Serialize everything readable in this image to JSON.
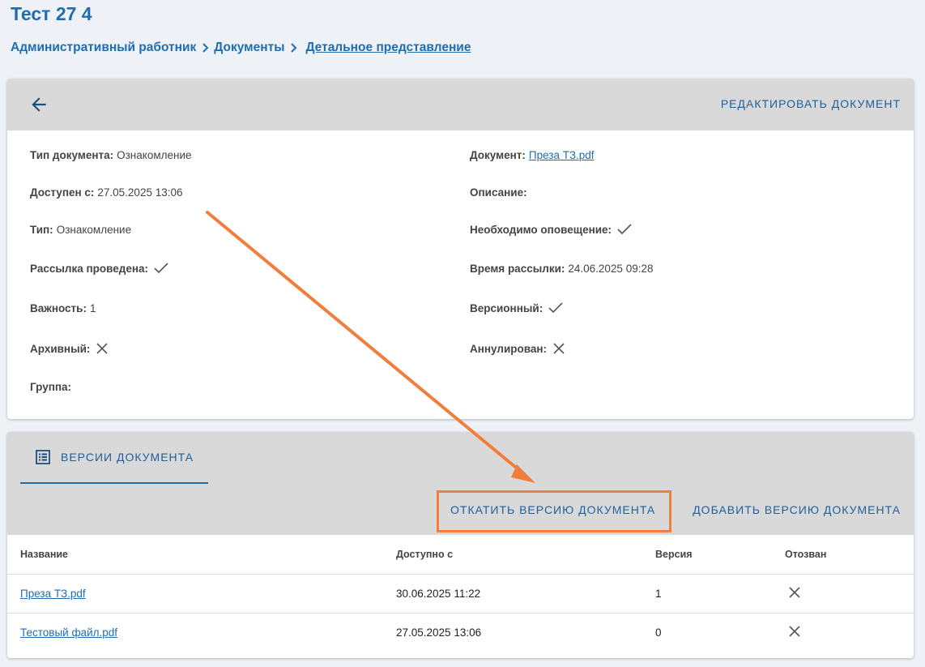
{
  "page": {
    "title": "Тест 27 4"
  },
  "breadcrumb": {
    "items": [
      "Административный работник",
      "Документы",
      "Детальное представление"
    ]
  },
  "details": {
    "edit_label": "РЕДАКТИРОВАТЬ ДОКУМЕНТ",
    "doc_type_label": "Тип документа:",
    "doc_type_value": "Ознакомление",
    "available_label": "Доступен с:",
    "available_value": "27.05.2025 13:06",
    "type_label": "Тип:",
    "type_value": "Ознакомление",
    "mailing_done_label": "Рассылка проведена:",
    "importance_label": "Важность:",
    "importance_value": "1",
    "archived_label": "Архивный:",
    "group_label": "Группа:",
    "document_label": "Документ:",
    "document_value": "Преза ТЗ.pdf",
    "description_label": "Описание:",
    "notify_label": "Необходимо оповещение:",
    "mailing_time_label": "Время рассылки:",
    "mailing_time_value": "24.06.2025 09:28",
    "versioned_label": "Версионный:",
    "annulled_label": "Аннулирован:"
  },
  "versions": {
    "tab_label": "ВЕРСИИ ДОКУМЕНТА",
    "rollback_label": "ОТКАТИТЬ ВЕРСИЮ ДОКУМЕНТА",
    "add_label": "ДОБАВИТЬ ВЕРСИЮ ДОКУМЕНТА",
    "columns": [
      "Название",
      "Доступно с",
      "Версия",
      "Отозван"
    ],
    "rows": [
      {
        "name": "Преза ТЗ.pdf",
        "date": "30.06.2025 11:22",
        "version": "1"
      },
      {
        "name": "Тестовый файл.pdf",
        "date": "27.05.2025 13:06",
        "version": "0"
      }
    ]
  },
  "colors": {
    "accent": "#1f6db0",
    "highlight": "#f07e3c"
  }
}
